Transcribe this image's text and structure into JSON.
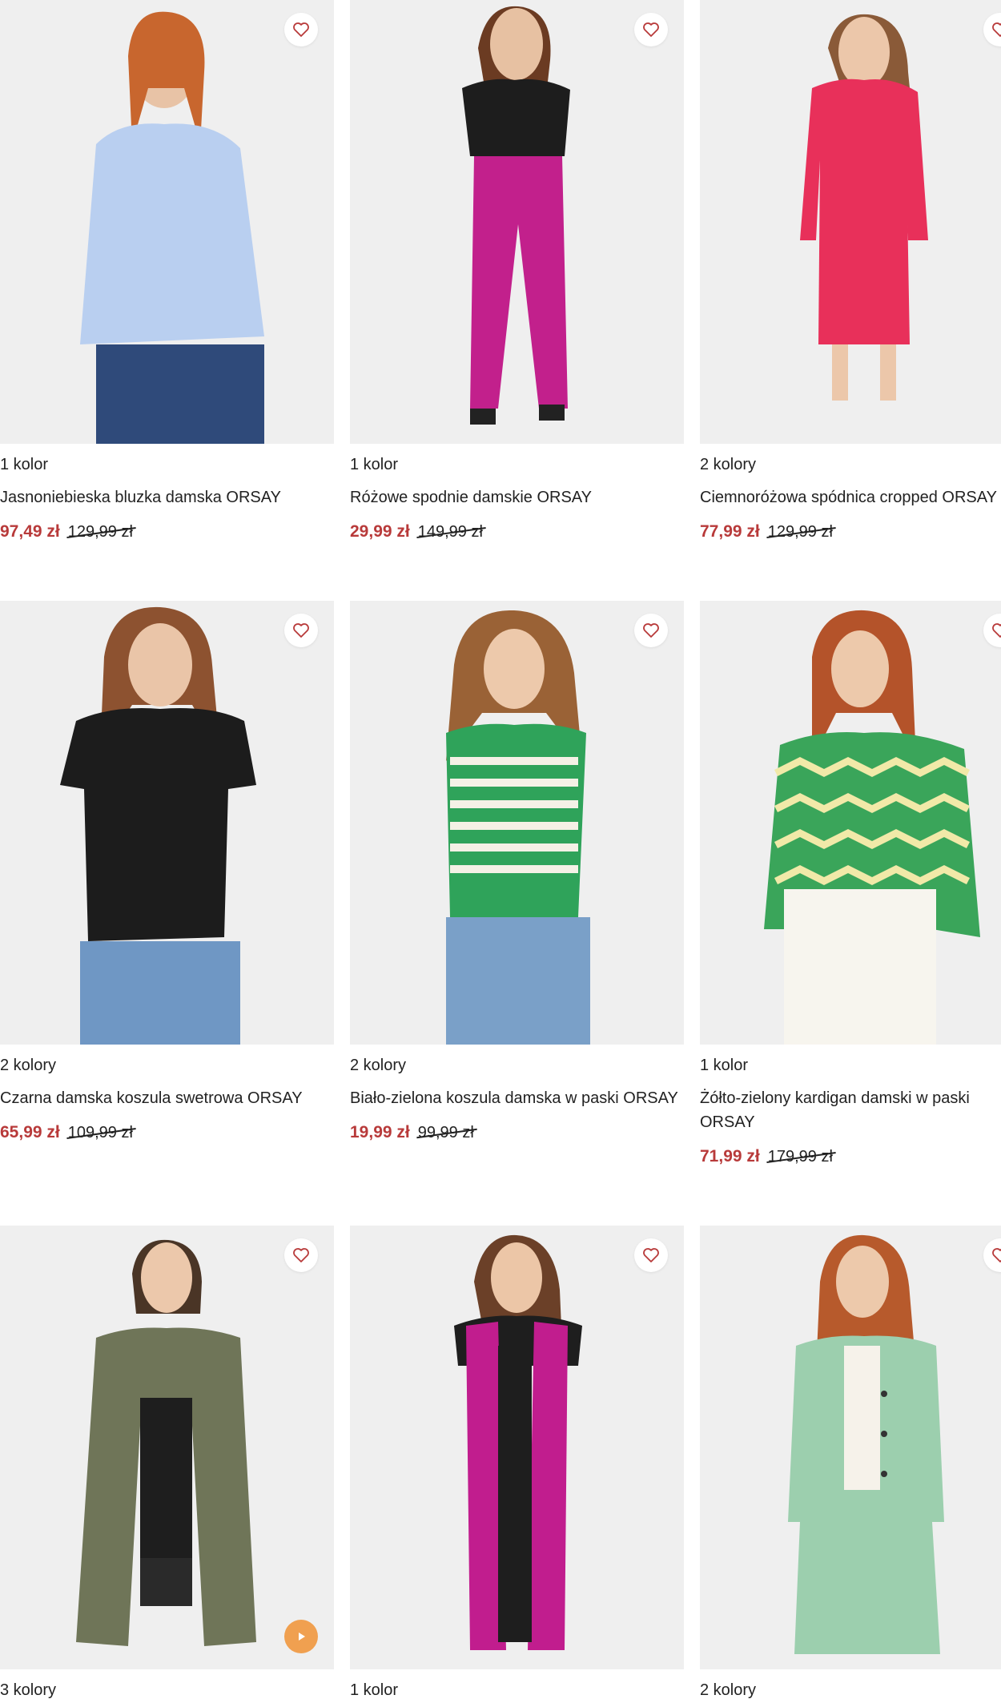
{
  "colors": {
    "sale_price": "#b83a3a",
    "heart_stroke": "#b83a3a",
    "play_button": "#f0a050",
    "photo_background": "#efefef"
  },
  "products": [
    {
      "colors_label": "1 kolor",
      "title": "Jasnoniebieska bluzka damska ORSAY",
      "price": "97,49 zł",
      "old_price": "129,99 zł",
      "garment_color": "#b9cff0",
      "icon": "heart-icon"
    },
    {
      "colors_label": "1 kolor",
      "title": "Różowe spodnie damskie ORSAY",
      "price": "29,99 zł",
      "old_price": "149,99 zł",
      "garment_color": "#c2208c",
      "icon": "heart-icon"
    },
    {
      "colors_label": "2 kolory",
      "title": "Ciemnoróżowa spódnica cropped ORSAY",
      "price": "77,99 zł",
      "old_price": "129,99 zł",
      "garment_color": "#e8305a",
      "icon": "heart-icon"
    },
    {
      "colors_label": "2 kolory",
      "title": "Czarna damska koszula swetrowa ORSAY",
      "price": "65,99 zł",
      "old_price": "109,99 zł",
      "garment_color": "#1c1c1c",
      "icon": "heart-icon"
    },
    {
      "colors_label": "2 kolory",
      "title": "Biało-zielona koszula damska w paski ORSAY",
      "price": "19,99 zł",
      "old_price": "99,99 zł",
      "garment_color": "#2fa35a",
      "icon": "heart-icon"
    },
    {
      "colors_label": "1 kolor",
      "title": "Żółto-zielony kardigan damski w paski ORSAY",
      "price": "71,99 zł",
      "old_price": "179,99 zł",
      "garment_color": "#3aa55a",
      "icon": "heart-icon"
    },
    {
      "colors_label": "3 kolory",
      "title": "",
      "price": "",
      "old_price": "",
      "garment_color": "#6f7558",
      "icon": "heart-icon",
      "video_icon": "play-icon"
    },
    {
      "colors_label": "1 kolor",
      "title": "",
      "price": "",
      "old_price": "",
      "garment_color": "#c11d8e",
      "icon": "heart-icon"
    },
    {
      "colors_label": "2 kolory",
      "title": "",
      "price": "",
      "old_price": "",
      "garment_color": "#9ccfae",
      "icon": "heart-icon"
    }
  ]
}
